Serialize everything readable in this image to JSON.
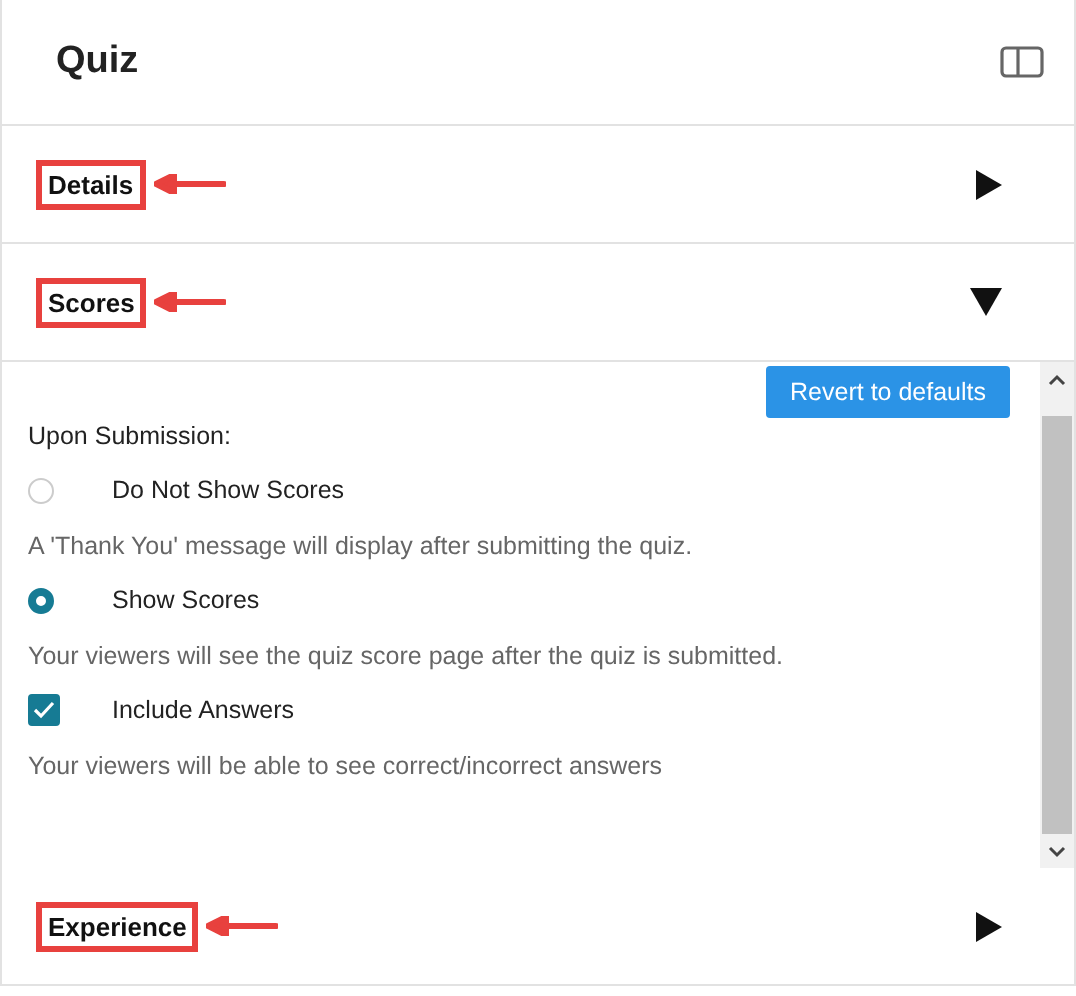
{
  "title": "Quiz",
  "sections": [
    {
      "label": "Details",
      "expanded": false,
      "highlighted": true
    },
    {
      "label": "Scores",
      "expanded": true,
      "highlighted": true,
      "content": {
        "button": "Revert to defaults",
        "heading": "Upon Submission:",
        "options": [
          {
            "kind": "radio",
            "label": "Do Not Show Scores",
            "selected": false,
            "description": "A 'Thank You' message will display after submitting the quiz."
          },
          {
            "kind": "radio",
            "label": "Show Scores",
            "selected": true,
            "description": "Your viewers will see the quiz score page after the quiz is submitted."
          },
          {
            "kind": "checkbox",
            "label": "Include Answers",
            "checked": true,
            "description": "Your viewers will be able to see correct/incorrect answers"
          }
        ]
      }
    },
    {
      "label": "Experience",
      "expanded": false,
      "highlighted": true
    }
  ]
}
